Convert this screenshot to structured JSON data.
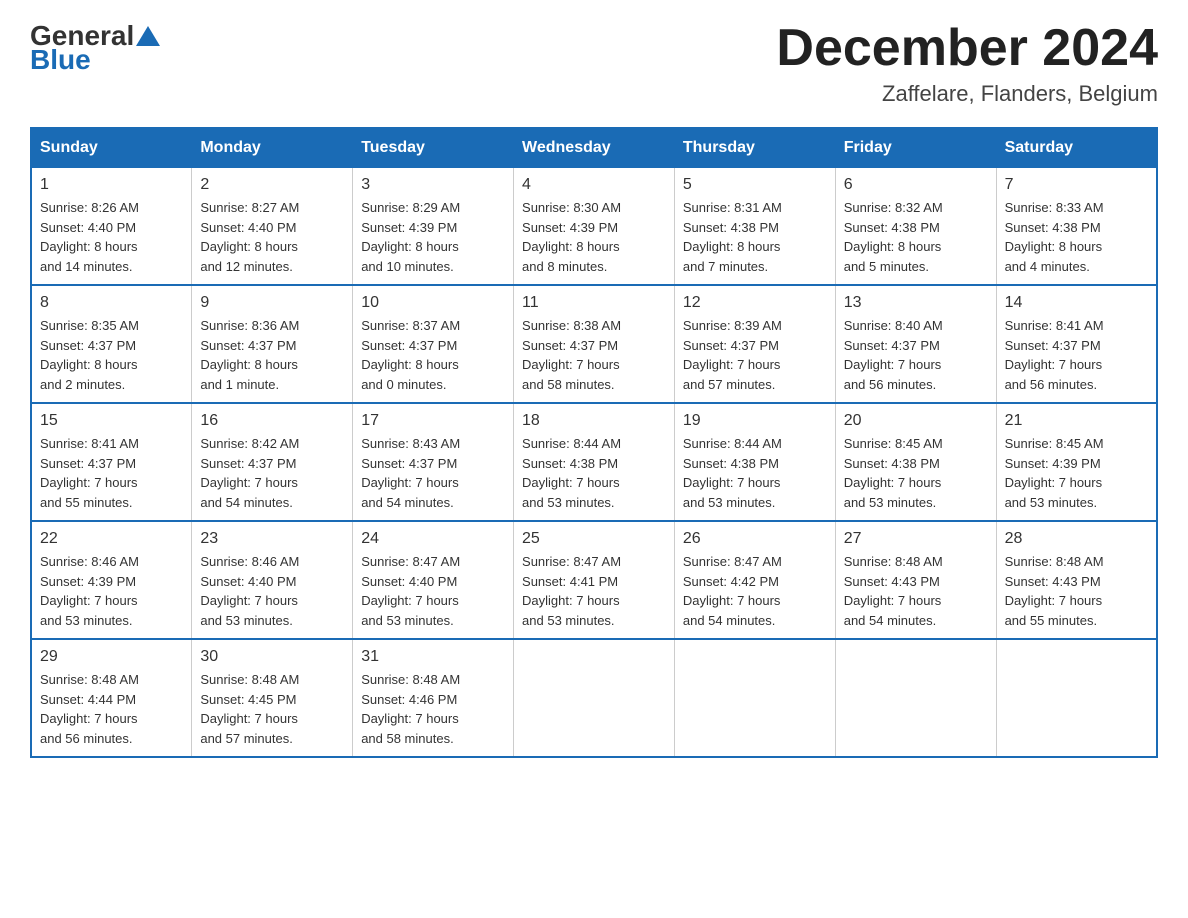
{
  "header": {
    "logo": {
      "general": "General",
      "blue": "Blue"
    },
    "title": "December 2024",
    "location": "Zaffelare, Flanders, Belgium"
  },
  "days_of_week": [
    "Sunday",
    "Monday",
    "Tuesday",
    "Wednesday",
    "Thursday",
    "Friday",
    "Saturday"
  ],
  "weeks": [
    [
      {
        "day": "1",
        "sunrise": "Sunrise: 8:26 AM",
        "sunset": "Sunset: 4:40 PM",
        "daylight": "Daylight: 8 hours",
        "daylight2": "and 14 minutes."
      },
      {
        "day": "2",
        "sunrise": "Sunrise: 8:27 AM",
        "sunset": "Sunset: 4:40 PM",
        "daylight": "Daylight: 8 hours",
        "daylight2": "and 12 minutes."
      },
      {
        "day": "3",
        "sunrise": "Sunrise: 8:29 AM",
        "sunset": "Sunset: 4:39 PM",
        "daylight": "Daylight: 8 hours",
        "daylight2": "and 10 minutes."
      },
      {
        "day": "4",
        "sunrise": "Sunrise: 8:30 AM",
        "sunset": "Sunset: 4:39 PM",
        "daylight": "Daylight: 8 hours",
        "daylight2": "and 8 minutes."
      },
      {
        "day": "5",
        "sunrise": "Sunrise: 8:31 AM",
        "sunset": "Sunset: 4:38 PM",
        "daylight": "Daylight: 8 hours",
        "daylight2": "and 7 minutes."
      },
      {
        "day": "6",
        "sunrise": "Sunrise: 8:32 AM",
        "sunset": "Sunset: 4:38 PM",
        "daylight": "Daylight: 8 hours",
        "daylight2": "and 5 minutes."
      },
      {
        "day": "7",
        "sunrise": "Sunrise: 8:33 AM",
        "sunset": "Sunset: 4:38 PM",
        "daylight": "Daylight: 8 hours",
        "daylight2": "and 4 minutes."
      }
    ],
    [
      {
        "day": "8",
        "sunrise": "Sunrise: 8:35 AM",
        "sunset": "Sunset: 4:37 PM",
        "daylight": "Daylight: 8 hours",
        "daylight2": "and 2 minutes."
      },
      {
        "day": "9",
        "sunrise": "Sunrise: 8:36 AM",
        "sunset": "Sunset: 4:37 PM",
        "daylight": "Daylight: 8 hours",
        "daylight2": "and 1 minute."
      },
      {
        "day": "10",
        "sunrise": "Sunrise: 8:37 AM",
        "sunset": "Sunset: 4:37 PM",
        "daylight": "Daylight: 8 hours",
        "daylight2": "and 0 minutes."
      },
      {
        "day": "11",
        "sunrise": "Sunrise: 8:38 AM",
        "sunset": "Sunset: 4:37 PM",
        "daylight": "Daylight: 7 hours",
        "daylight2": "and 58 minutes."
      },
      {
        "day": "12",
        "sunrise": "Sunrise: 8:39 AM",
        "sunset": "Sunset: 4:37 PM",
        "daylight": "Daylight: 7 hours",
        "daylight2": "and 57 minutes."
      },
      {
        "day": "13",
        "sunrise": "Sunrise: 8:40 AM",
        "sunset": "Sunset: 4:37 PM",
        "daylight": "Daylight: 7 hours",
        "daylight2": "and 56 minutes."
      },
      {
        "day": "14",
        "sunrise": "Sunrise: 8:41 AM",
        "sunset": "Sunset: 4:37 PM",
        "daylight": "Daylight: 7 hours",
        "daylight2": "and 56 minutes."
      }
    ],
    [
      {
        "day": "15",
        "sunrise": "Sunrise: 8:41 AM",
        "sunset": "Sunset: 4:37 PM",
        "daylight": "Daylight: 7 hours",
        "daylight2": "and 55 minutes."
      },
      {
        "day": "16",
        "sunrise": "Sunrise: 8:42 AM",
        "sunset": "Sunset: 4:37 PM",
        "daylight": "Daylight: 7 hours",
        "daylight2": "and 54 minutes."
      },
      {
        "day": "17",
        "sunrise": "Sunrise: 8:43 AM",
        "sunset": "Sunset: 4:37 PM",
        "daylight": "Daylight: 7 hours",
        "daylight2": "and 54 minutes."
      },
      {
        "day": "18",
        "sunrise": "Sunrise: 8:44 AM",
        "sunset": "Sunset: 4:38 PM",
        "daylight": "Daylight: 7 hours",
        "daylight2": "and 53 minutes."
      },
      {
        "day": "19",
        "sunrise": "Sunrise: 8:44 AM",
        "sunset": "Sunset: 4:38 PM",
        "daylight": "Daylight: 7 hours",
        "daylight2": "and 53 minutes."
      },
      {
        "day": "20",
        "sunrise": "Sunrise: 8:45 AM",
        "sunset": "Sunset: 4:38 PM",
        "daylight": "Daylight: 7 hours",
        "daylight2": "and 53 minutes."
      },
      {
        "day": "21",
        "sunrise": "Sunrise: 8:45 AM",
        "sunset": "Sunset: 4:39 PM",
        "daylight": "Daylight: 7 hours",
        "daylight2": "and 53 minutes."
      }
    ],
    [
      {
        "day": "22",
        "sunrise": "Sunrise: 8:46 AM",
        "sunset": "Sunset: 4:39 PM",
        "daylight": "Daylight: 7 hours",
        "daylight2": "and 53 minutes."
      },
      {
        "day": "23",
        "sunrise": "Sunrise: 8:46 AM",
        "sunset": "Sunset: 4:40 PM",
        "daylight": "Daylight: 7 hours",
        "daylight2": "and 53 minutes."
      },
      {
        "day": "24",
        "sunrise": "Sunrise: 8:47 AM",
        "sunset": "Sunset: 4:40 PM",
        "daylight": "Daylight: 7 hours",
        "daylight2": "and 53 minutes."
      },
      {
        "day": "25",
        "sunrise": "Sunrise: 8:47 AM",
        "sunset": "Sunset: 4:41 PM",
        "daylight": "Daylight: 7 hours",
        "daylight2": "and 53 minutes."
      },
      {
        "day": "26",
        "sunrise": "Sunrise: 8:47 AM",
        "sunset": "Sunset: 4:42 PM",
        "daylight": "Daylight: 7 hours",
        "daylight2": "and 54 minutes."
      },
      {
        "day": "27",
        "sunrise": "Sunrise: 8:48 AM",
        "sunset": "Sunset: 4:43 PM",
        "daylight": "Daylight: 7 hours",
        "daylight2": "and 54 minutes."
      },
      {
        "day": "28",
        "sunrise": "Sunrise: 8:48 AM",
        "sunset": "Sunset: 4:43 PM",
        "daylight": "Daylight: 7 hours",
        "daylight2": "and 55 minutes."
      }
    ],
    [
      {
        "day": "29",
        "sunrise": "Sunrise: 8:48 AM",
        "sunset": "Sunset: 4:44 PM",
        "daylight": "Daylight: 7 hours",
        "daylight2": "and 56 minutes."
      },
      {
        "day": "30",
        "sunrise": "Sunrise: 8:48 AM",
        "sunset": "Sunset: 4:45 PM",
        "daylight": "Daylight: 7 hours",
        "daylight2": "and 57 minutes."
      },
      {
        "day": "31",
        "sunrise": "Sunrise: 8:48 AM",
        "sunset": "Sunset: 4:46 PM",
        "daylight": "Daylight: 7 hours",
        "daylight2": "and 58 minutes."
      },
      null,
      null,
      null,
      null
    ]
  ]
}
